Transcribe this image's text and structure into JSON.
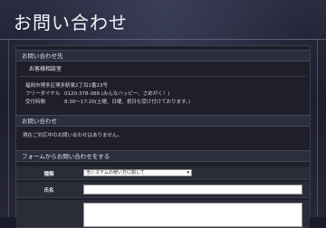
{
  "page": {
    "title": "お問い合わせ"
  },
  "contact_section": {
    "heading": "お問い合わせ先",
    "name": "お客様相談室",
    "rows": [
      {
        "label": "福岡市博多区博多駅東2丁目1番23号",
        "value": ""
      },
      {
        "label": "フリーダイヤル",
        "value": "0120-378-389 (みんなハッピー、さめがく！)"
      },
      {
        "label": "受付時間",
        "value": "8:30～17:20(土曜、日曜、祝日も受け付けております。)"
      }
    ]
  },
  "notice_section": {
    "heading": "お問い合わせ",
    "text": "現在ご対応中のお問い合わせはありません。"
  },
  "form_section": {
    "heading": "フォームからお問い合わせをする",
    "fields": {
      "category_label": "種類",
      "category_value": "当システムの使い方に関して",
      "name_label": "氏名",
      "name_value": "",
      "content_label": "",
      "content_value": ""
    }
  }
}
